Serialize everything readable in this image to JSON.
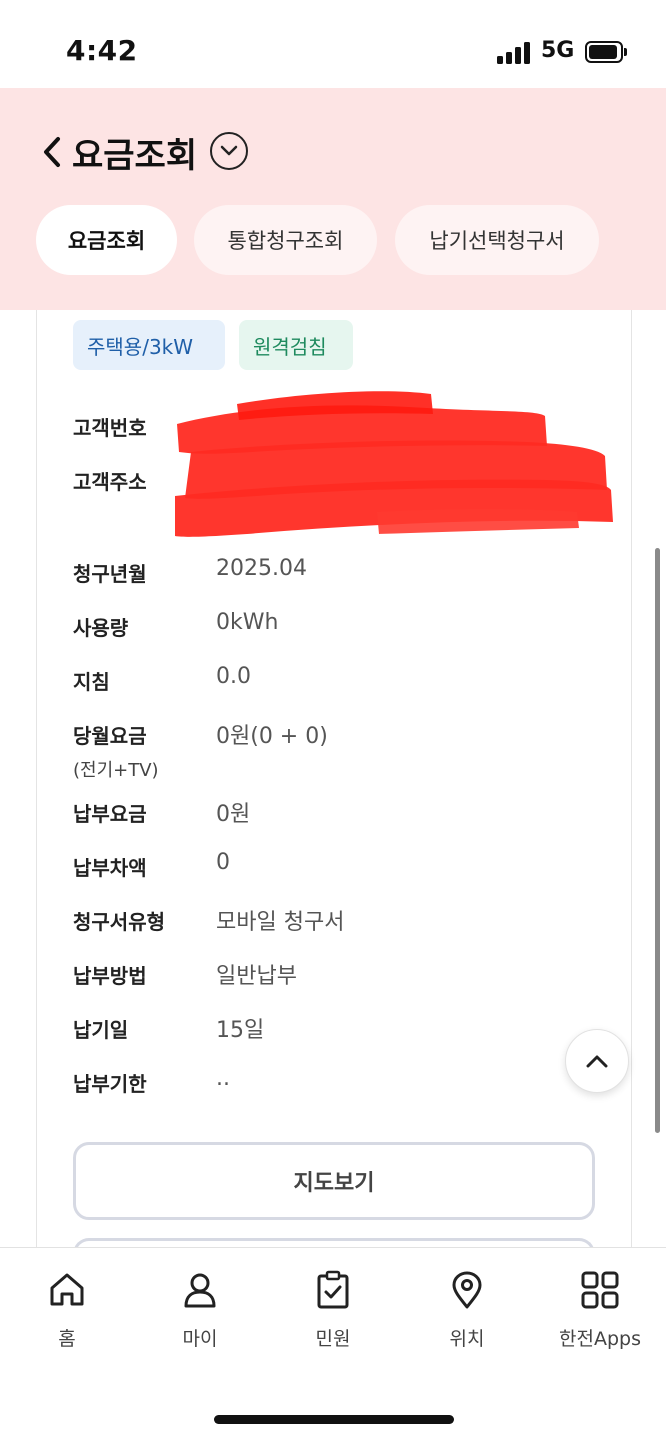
{
  "status_bar": {
    "time": "4:42",
    "network": "5G"
  },
  "header": {
    "title": "요금조회",
    "tabs": [
      {
        "label": "요금조회",
        "active": true
      },
      {
        "label": "통합청구조회",
        "active": false
      },
      {
        "label": "납기선택청구서",
        "active": false
      }
    ]
  },
  "tags": [
    "주택용/3kW",
    "원격검침"
  ],
  "customer": {
    "number_label": "고객번호",
    "address_label": "고객주소"
  },
  "details": [
    {
      "label": "청구년월",
      "value": "2025.04"
    },
    {
      "label": "사용량",
      "value": "0kWh"
    },
    {
      "label": "지침",
      "value": "0.0"
    },
    {
      "label": "당월요금",
      "sublabel": "(전기+TV)",
      "value": "0원(0 + 0)"
    },
    {
      "label": "납부요금",
      "value": "0원"
    },
    {
      "label": "납부차액",
      "value": "0"
    },
    {
      "label": "청구서유형",
      "value": "모바일 청구서"
    },
    {
      "label": "납부방법",
      "value": "일반납부"
    },
    {
      "label": "납기일",
      "value": "15일"
    },
    {
      "label": "납부기한",
      "value": ".."
    }
  ],
  "buttons": {
    "map_label": "지도보기"
  },
  "bottom_nav": [
    {
      "label": "홈",
      "icon": "home-icon"
    },
    {
      "label": "마이",
      "icon": "person-icon"
    },
    {
      "label": "민원",
      "icon": "clipboard-check-icon"
    },
    {
      "label": "위치",
      "icon": "location-pin-icon"
    },
    {
      "label": "한전Apps",
      "icon": "apps-grid-icon"
    }
  ],
  "colors": {
    "header_bg": "#fde4e4",
    "redaction": "#ff2b22",
    "tag_blue_bg": "#e6f0fb",
    "tag_blue_text": "#1f5fa8",
    "tag_green_bg": "#e6f6ef",
    "tag_green_text": "#1e8a5e"
  }
}
